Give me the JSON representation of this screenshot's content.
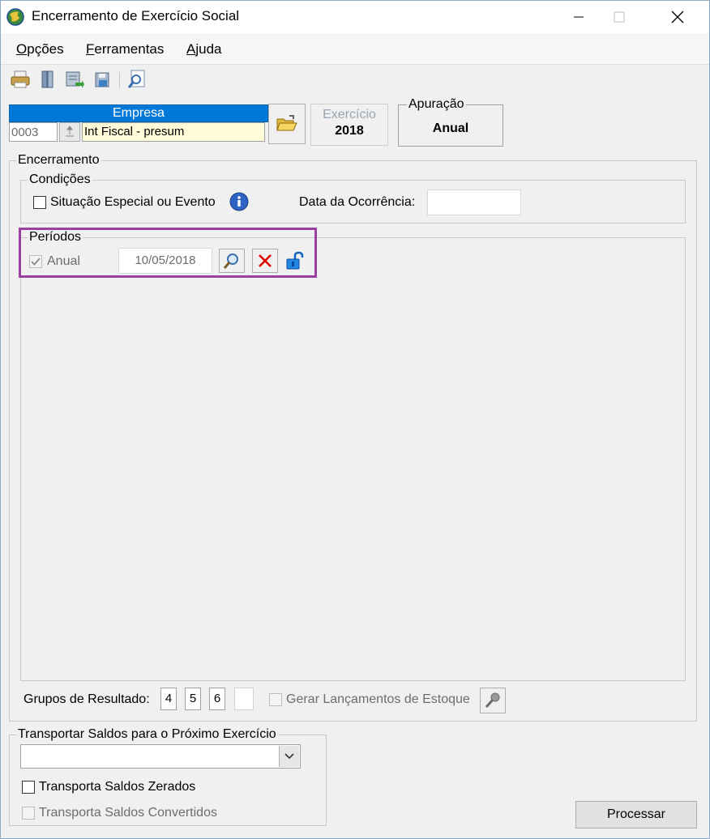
{
  "window": {
    "title": "Encerramento de Exercício Social"
  },
  "menu": {
    "opcoes": {
      "underline": "O",
      "rest": "pções"
    },
    "ferramentas": {
      "underline": "F",
      "rest": "erramentas"
    },
    "ajuda": {
      "underline": "A",
      "rest": "juda"
    }
  },
  "toolbar": {
    "icons": [
      "printer-icon",
      "book-icon",
      "export-icon",
      "save-disk-icon",
      "preview-icon"
    ]
  },
  "empresa": {
    "header": "Empresa",
    "code": "0003",
    "name": "Int Fiscal -  presum"
  },
  "exercicio": {
    "label": "Exercício",
    "value": "2018"
  },
  "apuracao": {
    "label": "Apuração",
    "value": "Anual"
  },
  "encerramento": {
    "label": "Encerramento",
    "condicoes": {
      "label": "Condições",
      "situacao_label": "Situação Especial ou Evento",
      "situacao_checked": false,
      "data_label": "Data da Ocorrência:",
      "data_value": ""
    },
    "periodos": {
      "label": "Períodos",
      "anual_label": "Anual",
      "anual_checked": true,
      "date_value": "10/05/2018"
    },
    "grupos": {
      "label": "Grupos de Resultado:",
      "values": [
        "4",
        "5",
        "6",
        ""
      ]
    },
    "gerar_label": "Gerar Lançamentos de Estoque"
  },
  "transportar": {
    "label": "Transportar Saldos para o Próximo Exercício",
    "selected": "",
    "zerados_label": "Transporta Saldos Zerados",
    "convertidos_label": "Transporta Saldos Convertidos"
  },
  "processar_label": "Processar",
  "colors": {
    "accent": "#0078d7",
    "highlight": "#9b3fa3",
    "empresa_bg": "#fffbd8",
    "delete_red": "#e00000"
  }
}
